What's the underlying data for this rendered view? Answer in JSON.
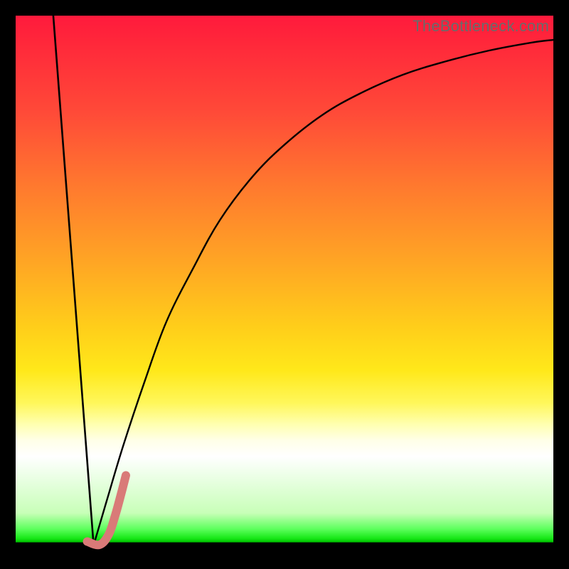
{
  "watermark": "TheBottleneck.com",
  "colors": {
    "frame": "#000000",
    "gradient_top": "#ff1a3c",
    "gradient_mid1": "#ff7a2e",
    "gradient_mid2": "#ffe81a",
    "gradient_mid3": "#ffffff",
    "gradient_green": "#18e818",
    "curve_black": "#000000",
    "accent_pink": "#d97a78"
  },
  "chart_data": {
    "type": "line",
    "title": "",
    "xlabel": "",
    "ylabel": "",
    "xlim": [
      0,
      100
    ],
    "ylim": [
      0,
      100
    ],
    "series": [
      {
        "name": "left-descent",
        "stroke": "curve_black",
        "width": 2.6,
        "points": [
          {
            "x": 7,
            "y": 100
          },
          {
            "x": 14.5,
            "y": 1.5
          }
        ]
      },
      {
        "name": "right-curve",
        "stroke": "curve_black",
        "width": 2.4,
        "points": [
          {
            "x": 14.5,
            "y": 1.5
          },
          {
            "x": 17,
            "y": 10
          },
          {
            "x": 20,
            "y": 20
          },
          {
            "x": 24,
            "y": 32
          },
          {
            "x": 28,
            "y": 43
          },
          {
            "x": 33,
            "y": 53
          },
          {
            "x": 38,
            "y": 62
          },
          {
            "x": 44,
            "y": 70
          },
          {
            "x": 50,
            "y": 76
          },
          {
            "x": 57,
            "y": 81.5
          },
          {
            "x": 64,
            "y": 85.5
          },
          {
            "x": 72,
            "y": 89
          },
          {
            "x": 80,
            "y": 91.5
          },
          {
            "x": 88,
            "y": 93.5
          },
          {
            "x": 96,
            "y": 95
          },
          {
            "x": 100,
            "y": 95.5
          }
        ]
      },
      {
        "name": "accent-j",
        "stroke": "accent_pink",
        "width": 12,
        "points": [
          {
            "x": 13.3,
            "y": 2.2
          },
          {
            "x": 15.6,
            "y": 1.6
          },
          {
            "x": 17.3,
            "y": 3.5
          },
          {
            "x": 18.5,
            "y": 7
          },
          {
            "x": 19.6,
            "y": 11
          },
          {
            "x": 20.5,
            "y": 14.5
          }
        ]
      }
    ]
  }
}
